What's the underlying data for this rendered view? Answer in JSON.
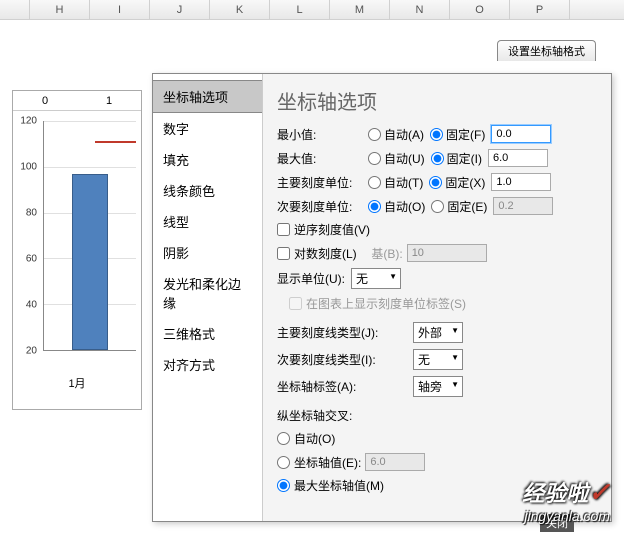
{
  "columns": [
    "",
    "H",
    "I",
    "J",
    "K",
    "L",
    "M",
    "N",
    "O",
    "P"
  ],
  "dialog_tab": "设置坐标轴格式",
  "chart_area_head": [
    "0",
    "1"
  ],
  "chart_x_label": "1月",
  "chart_y_ticks": [
    "120",
    "100",
    "80",
    "60",
    "40",
    "20"
  ],
  "sidebar": {
    "items": [
      "坐标轴选项",
      "数字",
      "填充",
      "线条颜色",
      "线型",
      "阴影",
      "发光和柔化边缘",
      "三维格式",
      "对齐方式"
    ]
  },
  "panel": {
    "title": "坐标轴选项",
    "min_label": "最小值:",
    "max_label": "最大值:",
    "major_unit_label": "主要刻度单位:",
    "minor_unit_label": "次要刻度单位:",
    "auto_a": "自动(A)",
    "auto_u": "自动(U)",
    "auto_t": "自动(T)",
    "auto_o": "自动(O)",
    "fixed_f": "固定(F)",
    "fixed_i": "固定(I)",
    "fixed_x": "固定(X)",
    "fixed_e": "固定(E)",
    "min_val": "0.0",
    "max_val": "6.0",
    "major_val": "1.0",
    "minor_val": "0.2",
    "reverse_order": "逆序刻度值(V)",
    "log_scale": "对数刻度(L)",
    "base_label": "基(B):",
    "base_val": "10",
    "display_unit_label": "显示单位(U):",
    "display_unit_val": "无",
    "show_unit_label": "在图表上显示刻度单位标签(S)",
    "major_tick_type_label": "主要刻度线类型(J):",
    "major_tick_type_val": "外部",
    "minor_tick_type_label": "次要刻度线类型(I):",
    "minor_tick_type_val": "无",
    "axis_label_label": "坐标轴标签(A):",
    "axis_label_val": "轴旁",
    "crosses_title": "纵坐标轴交叉:",
    "crosses_auto": "自动(O)",
    "crosses_value": "坐标轴值(E):",
    "crosses_value_val": "6.0",
    "crosses_max": "最大坐标轴值(M)"
  },
  "close_label": "关闭",
  "watermark": {
    "top": "经验啦",
    "bottom": "jingyanla.com"
  },
  "chart_data": {
    "type": "bar",
    "categories": [
      "1月"
    ],
    "values": [
      92
    ],
    "series2_line_marker": 115,
    "ylim": [
      0,
      120
    ],
    "y_major": 20,
    "title": "",
    "xlabel": "",
    "ylabel": ""
  }
}
